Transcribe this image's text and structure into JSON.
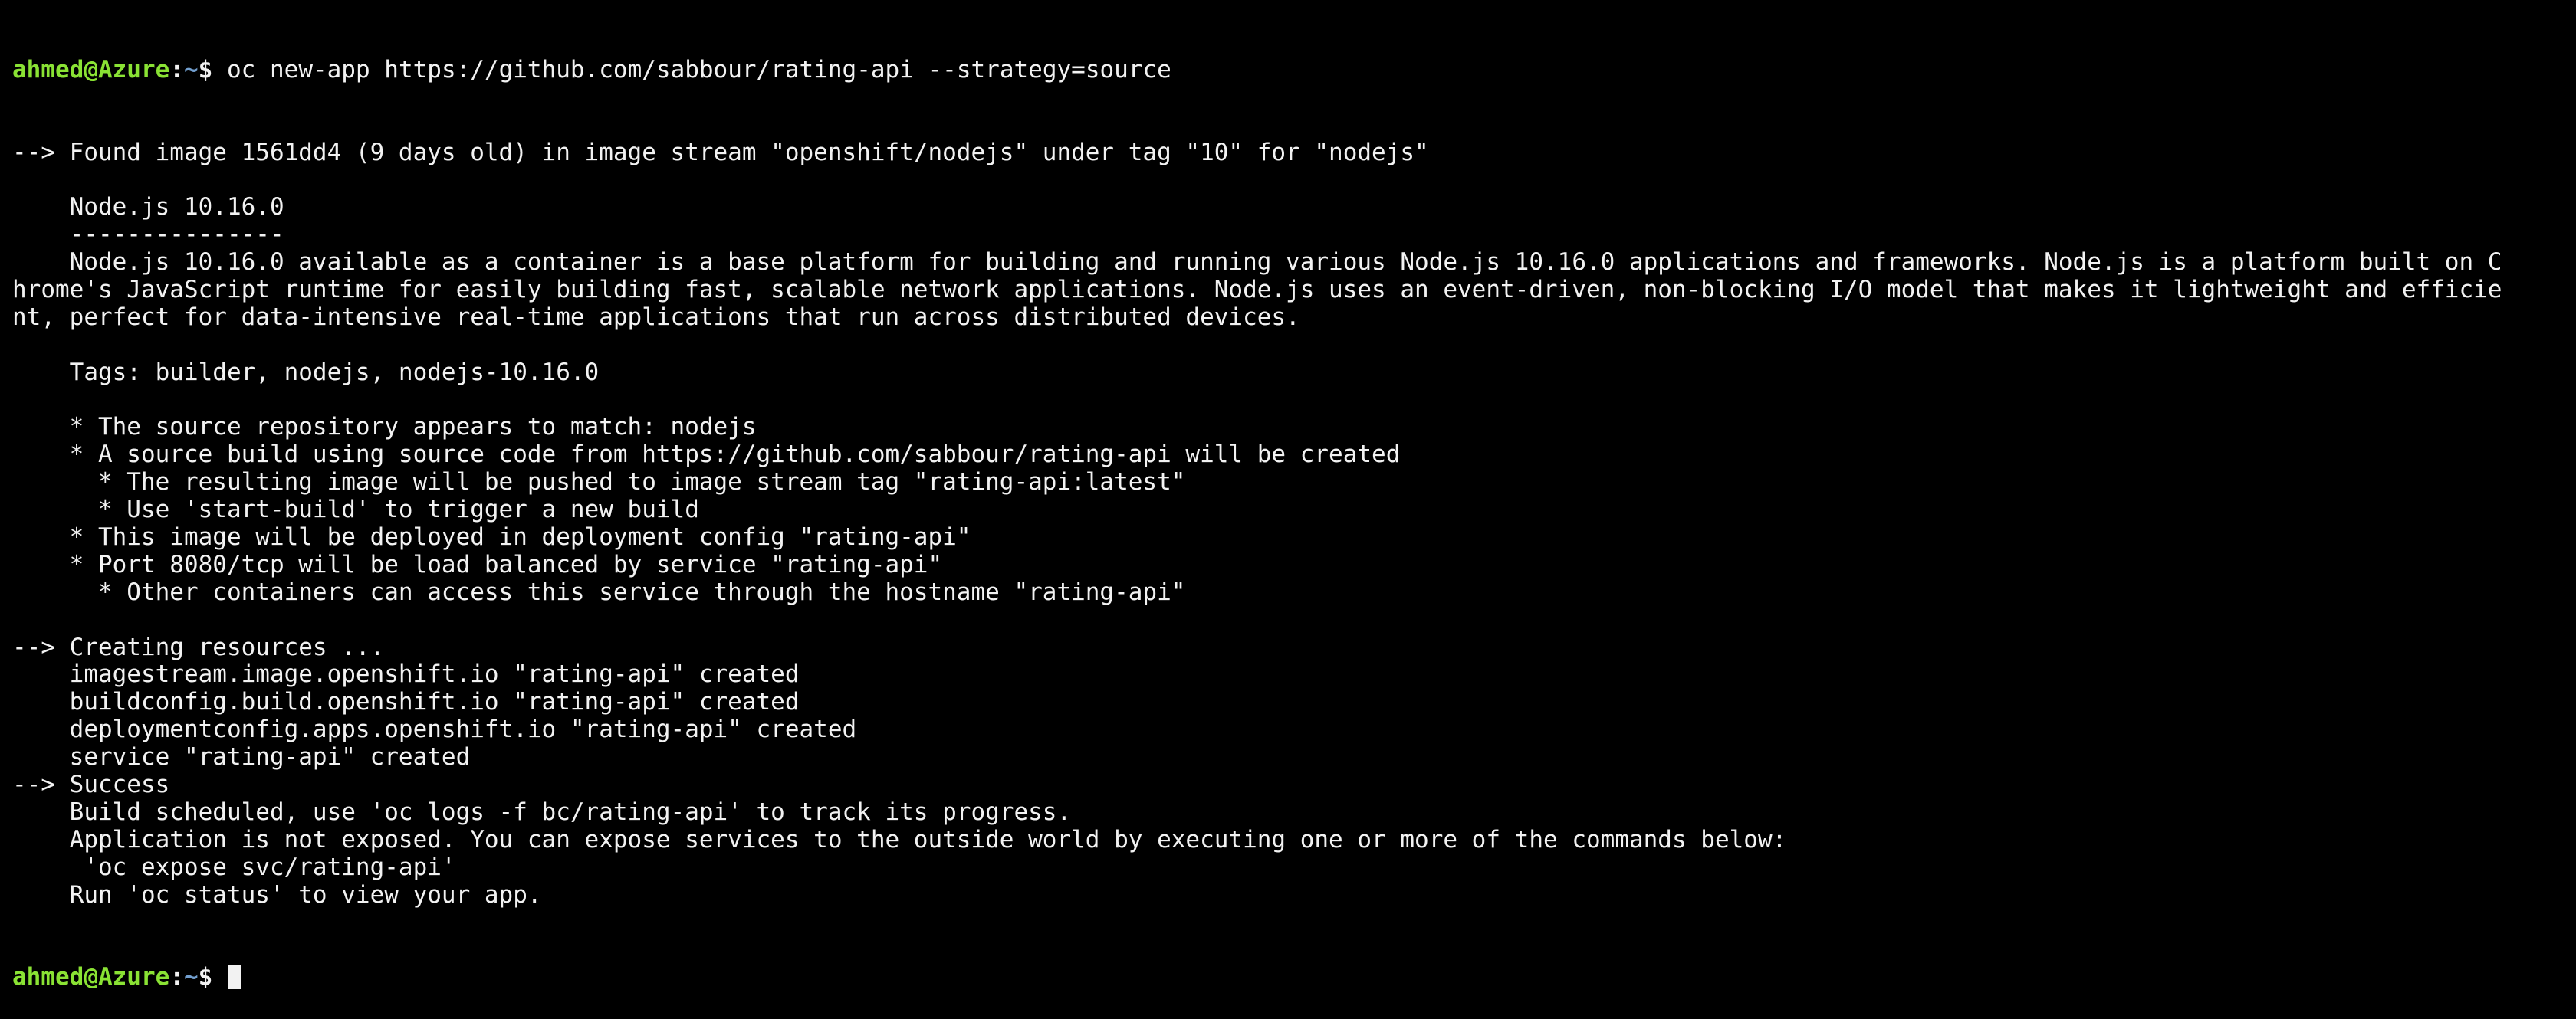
{
  "prompt": {
    "user_host": "ahmed@Azure",
    "separator": ":",
    "path": "~",
    "symbol": "$"
  },
  "command": "oc new-app https://github.com/sabbour/rating-api --strategy=source",
  "output_lines": [
    "--> Found image 1561dd4 (9 days old) in image stream \"openshift/nodejs\" under tag \"10\" for \"nodejs\"",
    "",
    "    Node.js 10.16.0",
    "    ---------------",
    "    Node.js 10.16.0 available as a container is a base platform for building and running various Node.js 10.16.0 applications and frameworks. Node.js is a platform built on C",
    "hrome's JavaScript runtime for easily building fast, scalable network applications. Node.js uses an event-driven, non-blocking I/O model that makes it lightweight and efficie",
    "nt, perfect for data-intensive real-time applications that run across distributed devices.",
    "",
    "    Tags: builder, nodejs, nodejs-10.16.0",
    "",
    "    * The source repository appears to match: nodejs",
    "    * A source build using source code from https://github.com/sabbour/rating-api will be created",
    "      * The resulting image will be pushed to image stream tag \"rating-api:latest\"",
    "      * Use 'start-build' to trigger a new build",
    "    * This image will be deployed in deployment config \"rating-api\"",
    "    * Port 8080/tcp will be load balanced by service \"rating-api\"",
    "      * Other containers can access this service through the hostname \"rating-api\"",
    "",
    "--> Creating resources ...",
    "    imagestream.image.openshift.io \"rating-api\" created",
    "    buildconfig.build.openshift.io \"rating-api\" created",
    "    deploymentconfig.apps.openshift.io \"rating-api\" created",
    "    service \"rating-api\" created",
    "--> Success",
    "    Build scheduled, use 'oc logs -f bc/rating-api' to track its progress.",
    "    Application is not exposed. You can expose services to the outside world by executing one or more of the commands below:",
    "     'oc expose svc/rating-api'",
    "    Run 'oc status' to view your app."
  ]
}
